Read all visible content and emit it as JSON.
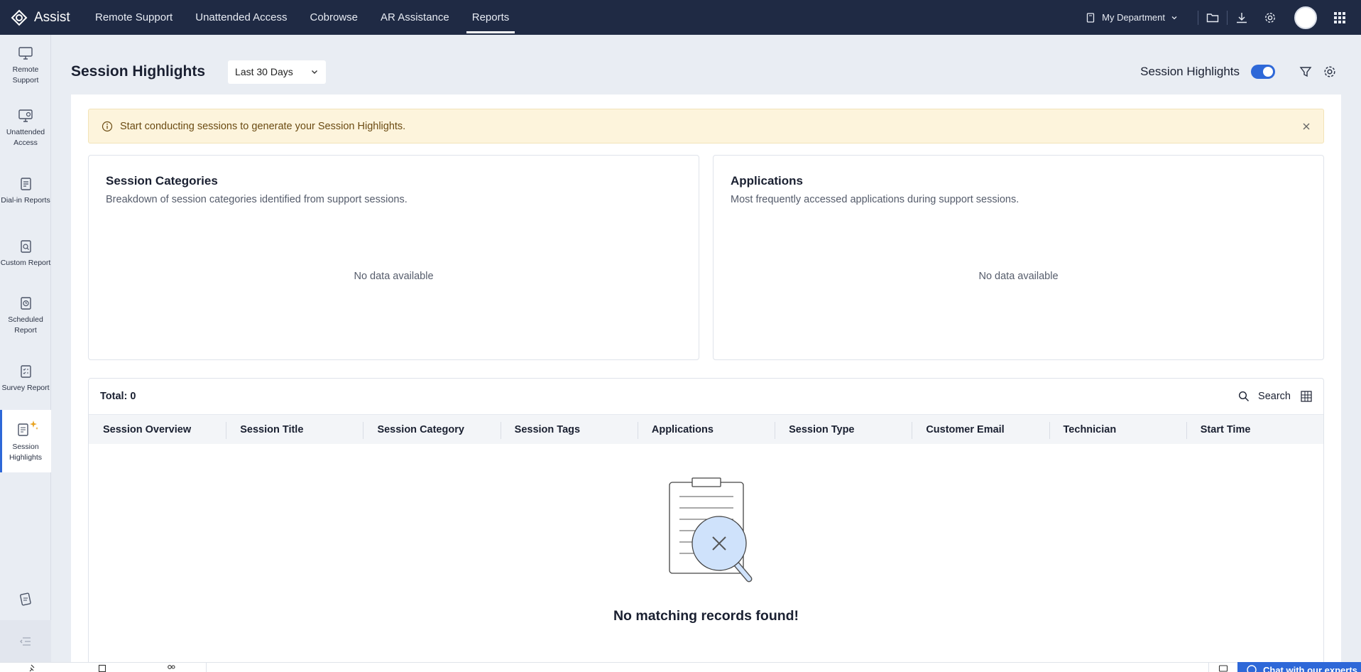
{
  "app": {
    "name": "Assist"
  },
  "topnav": {
    "tabs": [
      {
        "label": "Remote Support"
      },
      {
        "label": "Unattended Access"
      },
      {
        "label": "Cobrowse"
      },
      {
        "label": "AR Assistance"
      },
      {
        "label": "Reports",
        "active": true
      }
    ],
    "department": "My Department"
  },
  "sidebar": {
    "items": [
      {
        "label": "Remote Support",
        "icon": "monitor-icon"
      },
      {
        "label": "Unattended Access",
        "icon": "unattended-monitor-icon"
      },
      {
        "label": "Dial-in Reports",
        "icon": "report-icon"
      },
      {
        "label": "Custom Report",
        "icon": "report-search-icon"
      },
      {
        "label": "Scheduled Report",
        "icon": "report-clock-icon"
      },
      {
        "label": "Survey Report",
        "icon": "report-survey-icon"
      },
      {
        "label": "Session Highlights",
        "icon": "report-sparkle-icon",
        "active": true
      }
    ]
  },
  "header": {
    "title": "Session Highlights",
    "range": "Last 30 Days",
    "toggle_label": "Session Highlights",
    "toggle_on": true
  },
  "alert": {
    "text": "Start conducting sessions to generate your Session Highlights."
  },
  "cards": [
    {
      "title": "Session Categories",
      "description": "Breakdown of session categories identified from support sessions.",
      "empty": "No data available"
    },
    {
      "title": "Applications",
      "description": "Most frequently accessed applications during support sessions.",
      "empty": "No data available"
    }
  ],
  "table": {
    "total": "Total: 0",
    "search_label": "Search",
    "columns": [
      "Session Overview",
      "Session Title",
      "Session Category",
      "Session Tags",
      "Applications",
      "Session Type",
      "Customer Email",
      "Technician",
      "Start Time"
    ],
    "empty_message": "No matching records found!"
  },
  "chat": {
    "label": "Chat with our experts"
  },
  "colors": {
    "nav_bg": "#1f2a44",
    "accent": "#2e68d8",
    "alert_bg": "#fdf4dc"
  }
}
